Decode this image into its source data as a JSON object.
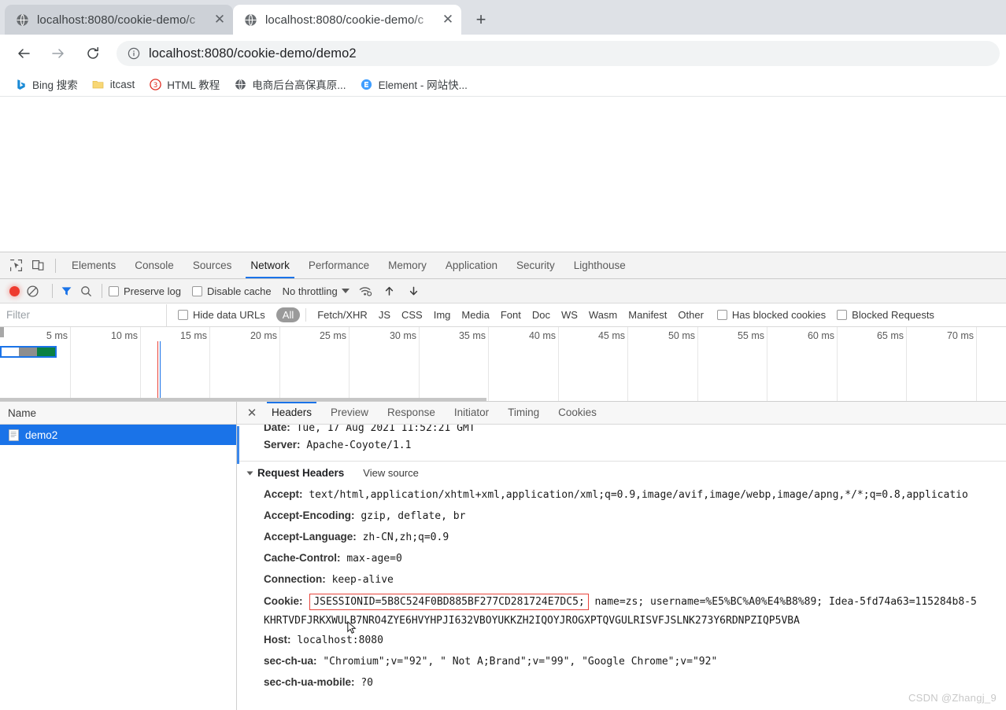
{
  "browser": {
    "tabs": [
      {
        "title": "localhost:8080/cookie-demo/c",
        "favicon": "globe-icon",
        "active": false
      },
      {
        "title": "localhost:8080/cookie-demo/c",
        "favicon": "globe-icon",
        "active": true
      }
    ],
    "new_tab_label": "+",
    "close_label": "✕",
    "nav": {
      "back": "←",
      "forward": "→",
      "reload": "⟳"
    },
    "omnibox": {
      "info_icon": "info-circle-icon",
      "url_scheme": "",
      "url": "localhost:8080/cookie-demo/demo2"
    },
    "bookmarks": [
      {
        "label": "Bing 搜索",
        "icon": "bing-icon"
      },
      {
        "label": "itcast",
        "icon": "folder-icon"
      },
      {
        "label": "HTML 教程",
        "icon": "html-tutorial-icon"
      },
      {
        "label": "电商后台高保真原...",
        "icon": "globe-icon"
      },
      {
        "label": "Element - 网站快...",
        "icon": "element-icon"
      }
    ]
  },
  "devtools": {
    "panels": [
      "Elements",
      "Console",
      "Sources",
      "Network",
      "Performance",
      "Memory",
      "Application",
      "Security",
      "Lighthouse"
    ],
    "selected_panel": "Network",
    "left_icons": [
      "inspect-element-icon",
      "device-toolbar-icon"
    ],
    "network_toolbar": {
      "record_icon": "record-stop-icon",
      "clear_icon": "clear-icon",
      "filter_icon": "filter-funnel-icon",
      "search_icon": "search-icon",
      "preserve_log": {
        "label": "Preserve log",
        "checked": false
      },
      "disable_cache": {
        "label": "Disable cache",
        "checked": false
      },
      "throttling": "No throttling",
      "throttling_caret": "chevron-down-icon",
      "wifi_icon": "network-conditions-icon",
      "import_icon": "import-har-icon",
      "export_icon": "export-har-icon"
    },
    "filter_bar": {
      "placeholder": "Filter",
      "value": "",
      "hide_data_urls": {
        "label": "Hide data URLs",
        "checked": false
      },
      "types": [
        "All",
        "Fetch/XHR",
        "JS",
        "CSS",
        "Img",
        "Media",
        "Font",
        "Doc",
        "WS",
        "Wasm",
        "Manifest",
        "Other"
      ],
      "selected_type": "All",
      "has_blocked_cookies": {
        "label": "Has blocked cookies",
        "checked": false
      },
      "blocked_requests": {
        "label": "Blocked Requests",
        "checked": false
      }
    },
    "timeline": {
      "ticks": [
        "5 ms",
        "10 ms",
        "15 ms",
        "20 ms",
        "25 ms",
        "30 ms",
        "35 ms",
        "40 ms",
        "45 ms",
        "50 ms",
        "55 ms",
        "60 ms",
        "65 ms",
        "70 ms"
      ]
    },
    "request_list": {
      "column_header": "Name",
      "rows": [
        {
          "name": "demo2",
          "icon": "document-icon",
          "selected": true
        }
      ]
    },
    "detail": {
      "close_icon": "close-icon",
      "tabs": [
        "Headers",
        "Preview",
        "Response",
        "Initiator",
        "Timing",
        "Cookies"
      ],
      "selected_tab": "Headers",
      "response_headers_partial": [
        {
          "key": "Date:",
          "value": "Tue, 17 Aug 2021 11:52:21 GMT"
        },
        {
          "key": "Server:",
          "value": "Apache-Coyote/1.1"
        }
      ],
      "section": {
        "title": "Request Headers",
        "view_source": "View source",
        "expanded": true
      },
      "request_headers": [
        {
          "key": "Accept:",
          "value": "text/html,application/xhtml+xml,application/xml;q=0.9,image/avif,image/webp,image/apng,*/*;q=0.8,applicatio"
        },
        {
          "key": "Accept-Encoding:",
          "value": "gzip, deflate, br"
        },
        {
          "key": "Accept-Language:",
          "value": "zh-CN,zh;q=0.9"
        },
        {
          "key": "Cache-Control:",
          "value": "max-age=0"
        },
        {
          "key": "Connection:",
          "value": "keep-alive"
        }
      ],
      "cookie_header": {
        "key": "Cookie:",
        "highlighted": "JSESSIONID=5B8C524F0BD885BF277CD281724E7DC5;",
        "rest": " name=zs; username=%E5%BC%A0%E4%B8%89; Idea-5fd74a63=115284b8-5",
        "wrapped_line": "KHRTVDFJRKXWULB7NRO4ZYE6HVYHPJI632VBOYUKKZH2IQOYJROGXPTQVGULRISVFJSLNK273Y6RDNPZIQP5VBA"
      },
      "trailing_headers": [
        {
          "key": "Host:",
          "value": "localhost:8080"
        },
        {
          "key": "sec-ch-ua:",
          "value": "\"Chromium\";v=\"92\", \" Not A;Brand\";v=\"99\", \"Google Chrome\";v=\"92\""
        },
        {
          "key": "sec-ch-ua-mobile:",
          "value": "?0"
        }
      ]
    }
  },
  "watermark": "CSDN @Zhangj_9",
  "colors": {
    "accent": "#1a73e8",
    "record": "#ee3b2f",
    "highlight_border": "#e8453c",
    "waterfall_green": "#0b8043",
    "tab_inactive": "#cdd1d7",
    "tabstrip_bg": "#dee1e6"
  }
}
